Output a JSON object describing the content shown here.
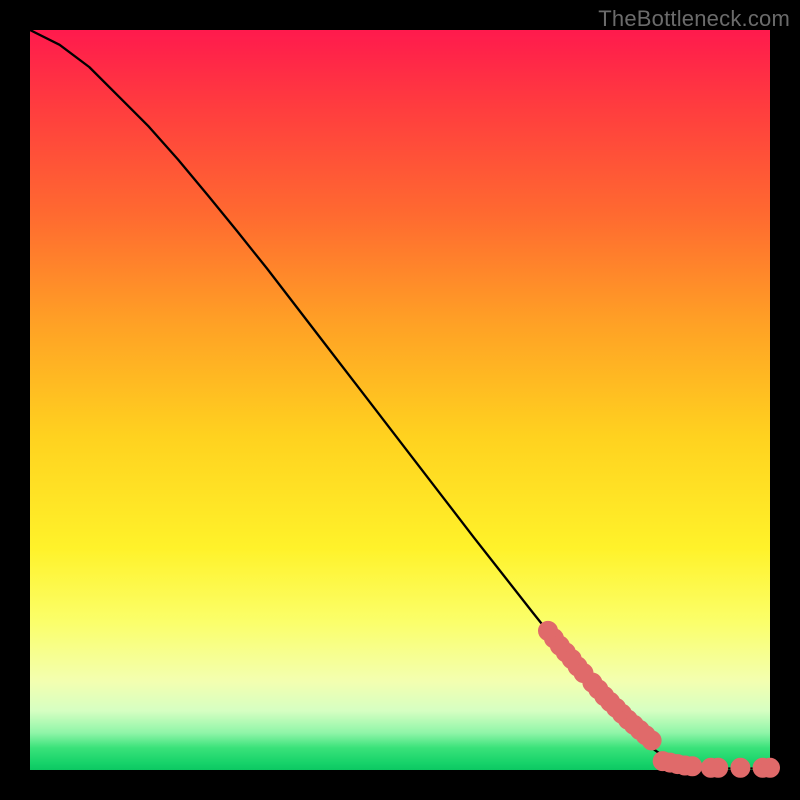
{
  "watermark": "TheBottleneck.com",
  "chart_data": {
    "type": "line",
    "title": "",
    "xlabel": "",
    "ylabel": "",
    "xlim": [
      0,
      100
    ],
    "ylim": [
      0,
      100
    ],
    "grid": false,
    "series": [
      {
        "name": "curve",
        "x": [
          0,
          4,
          8,
          12,
          16,
          20,
          24,
          28,
          32,
          36,
          40,
          44,
          48,
          52,
          56,
          60,
          64,
          68,
          72,
          76,
          80,
          84,
          86,
          88,
          90,
          92,
          94,
          96,
          98,
          100
        ],
        "y": [
          100,
          98,
          95,
          91,
          87,
          82.5,
          77.7,
          72.8,
          67.8,
          62.6,
          57.4,
          52.2,
          47.0,
          41.8,
          36.6,
          31.4,
          26.3,
          21.2,
          16.2,
          11.4,
          6.8,
          3.0,
          1.6,
          0.8,
          0.4,
          0.25,
          0.2,
          0.2,
          0.2,
          0.2
        ]
      }
    ],
    "scatter": [
      {
        "name": "cluster-upper",
        "x": [
          70.0,
          70.8,
          71.6,
          72.4,
          73.2,
          74.0,
          74.8,
          76.0,
          76.8,
          77.6,
          78.4,
          79.2,
          80.0,
          80.8,
          81.6,
          82.4,
          83.2,
          84.0
        ],
        "y": [
          18.8,
          17.8,
          16.8,
          15.9,
          15.0,
          14.0,
          13.1,
          11.8,
          10.9,
          10.0,
          9.2,
          8.4,
          7.6,
          6.8,
          6.1,
          5.4,
          4.7,
          4.0
        ]
      },
      {
        "name": "cluster-bottom",
        "x": [
          85.5,
          86.5,
          87.5,
          88.5,
          89.5,
          92.0,
          93.0,
          96.0,
          99.0,
          100.0
        ],
        "y": [
          1.2,
          1.0,
          0.8,
          0.6,
          0.5,
          0.3,
          0.3,
          0.3,
          0.3,
          0.3
        ]
      }
    ]
  },
  "colors": {
    "dot": "#e06a6a",
    "line": "#000000"
  }
}
